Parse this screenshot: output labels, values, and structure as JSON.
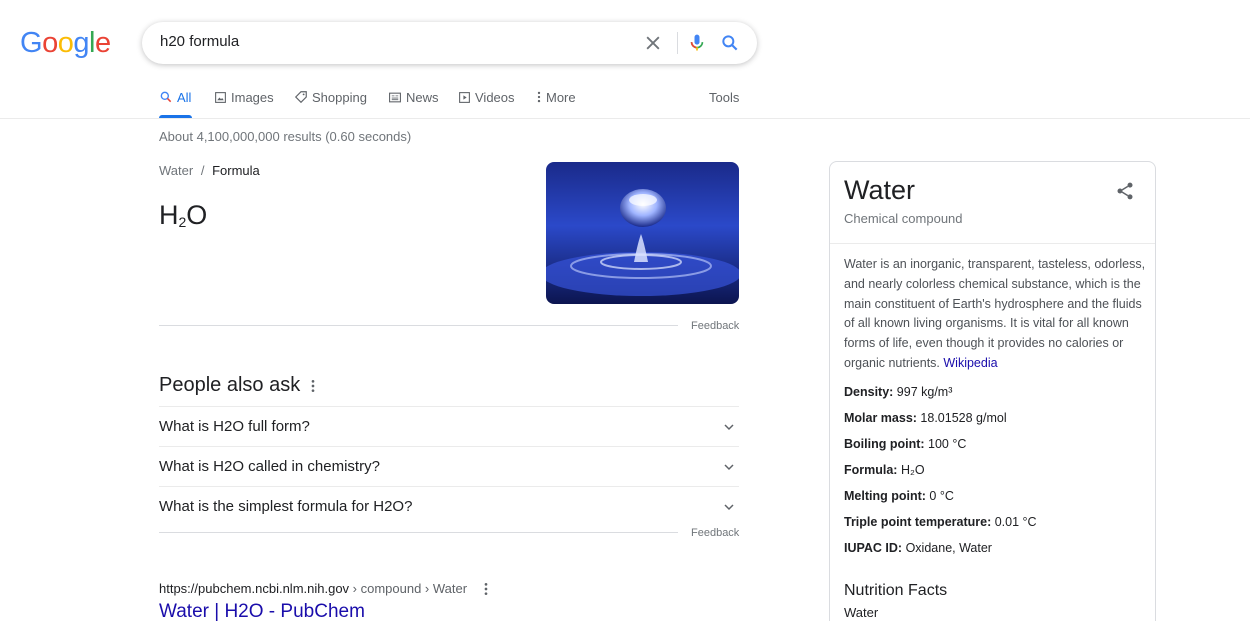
{
  "logo": {
    "letters": [
      {
        "ch": "G",
        "color": "#4285F4"
      },
      {
        "ch": "o",
        "color": "#EA4335"
      },
      {
        "ch": "o",
        "color": "#FBBC05"
      },
      {
        "ch": "g",
        "color": "#4285F4"
      },
      {
        "ch": "l",
        "color": "#34A853"
      },
      {
        "ch": "e",
        "color": "#EA4335"
      }
    ]
  },
  "search": {
    "value": "h20 formula"
  },
  "tabs": [
    {
      "label": "All",
      "icon": "search-icon",
      "active": true
    },
    {
      "label": "Images",
      "icon": "image-icon"
    },
    {
      "label": "Shopping",
      "icon": "tag-icon"
    },
    {
      "label": "News",
      "icon": "newspaper-icon"
    },
    {
      "label": "Videos",
      "icon": "play-icon"
    },
    {
      "label": "More",
      "icon": "vertical-dots-icon"
    }
  ],
  "tools_label": "Tools",
  "result_stats": "About 4,100,000,000 results (0.60 seconds)",
  "snippet": {
    "breadcrumb_parent": "Water",
    "breadcrumb_sep": "/",
    "breadcrumb_current": "Formula",
    "answer_main": "H",
    "answer_sub": "2",
    "answer_tail": "O",
    "feedback": "Feedback"
  },
  "paa": {
    "title": "People also ask",
    "questions": [
      "What is H2O full form?",
      "What is H2O called in chemistry?",
      "What is the simplest formula for H2O?"
    ],
    "feedback": "Feedback"
  },
  "result": {
    "url_host": "https://pubchem.ncbi.nlm.nih.gov",
    "url_path": " › compound › Water",
    "title": "Water | H2O - PubChem"
  },
  "knowledge_panel": {
    "title": "Water",
    "subtitle": "Chemical compound",
    "description": "Water is an inorganic, transparent, tasteless, odorless, and nearly colorless chemical substance, which is the main constituent of Earth's hydrosphere and the fluids of all known living organisms. It is vital for all known forms of life, even though it provides no calories or organic nutrients.",
    "source": "Wikipedia",
    "facts": [
      {
        "label": "Density:",
        "value": " 997 kg/m³"
      },
      {
        "label": "Molar mass:",
        "value": " 18.01528 g/mol"
      },
      {
        "label": "Boiling point:",
        "value": " 100 °C"
      },
      {
        "label": "Formula:",
        "value": " H₂O"
      },
      {
        "label": "Melting point:",
        "value": " 0 °C"
      },
      {
        "label": "Triple point temperature:",
        "value": " 0.01 °C"
      },
      {
        "label": "IUPAC ID:",
        "value": " Oxidane, Water"
      }
    ],
    "nutrition_title": "Nutrition Facts",
    "nutrition_sub": "Water"
  }
}
